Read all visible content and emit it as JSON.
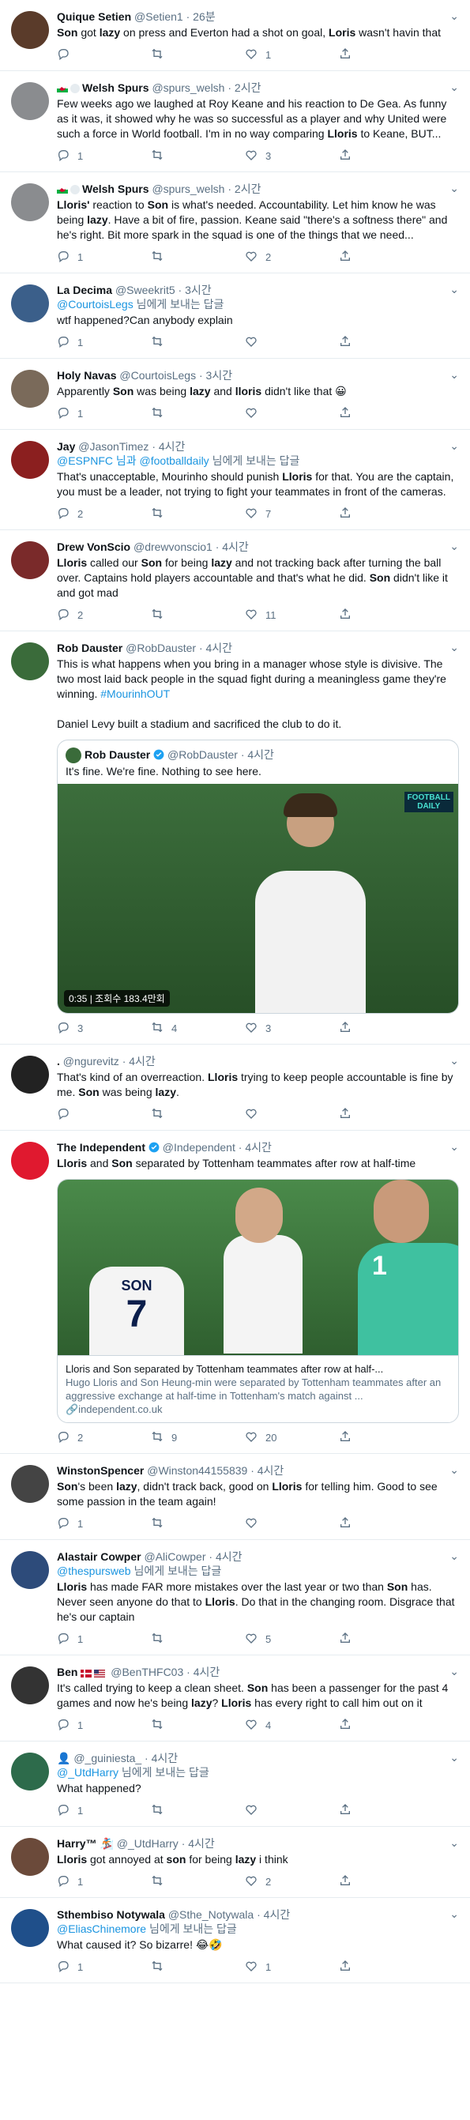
{
  "colors": {
    "accent": "#1da1f2",
    "muted": "#5b7083",
    "link": "#1b95e0",
    "border": "#e6ecf0"
  },
  "labels": {
    "reply_prefix": "@",
    "reply_to": "님에게 보내는 답글",
    "retweeted": ""
  },
  "tweets": [
    {
      "name": "Quique Setien",
      "handle": "@Setien1",
      "time": "26분",
      "avatar_color": "#5a3b2a",
      "body_html": "<b>Son</b> got <b>lazy</b> on press and Everton had a shot on goal, <b>Loris</b> wasn't havin that",
      "reply_count": "",
      "rt_count": "",
      "like_count": "1"
    },
    {
      "name": "Welsh Spurs",
      "handle": "@spurs_welsh",
      "time": "2시간",
      "flags": true,
      "avatar_color": "#8a8c8f",
      "body_html": "Few weeks ago we laughed at Roy Keane and his reaction to De Gea. As funny as it was, it showed why he was so successful as a player and why United were such a force in World football. I'm in no way comparing <b>Lloris</b> to Keane, BUT...",
      "reply_count": "1",
      "rt_count": "",
      "like_count": "3"
    },
    {
      "name": "Welsh Spurs",
      "handle": "@spurs_welsh",
      "time": "2시간",
      "flags": true,
      "avatar_color": "#8a8c8f",
      "body_html": "<b>Lloris'</b> reaction to <b>Son</b> is what's needed. Accountability. Let him know he was being <b>lazy</b>. Have a bit of fire, passion. Keane said \"there's a softness there\" and he's right. Bit more spark in the squad is one of the things that we need...",
      "reply_count": "1",
      "rt_count": "",
      "like_count": "2"
    },
    {
      "name": "La Decima",
      "handle": "@Sweekrit5",
      "time": "3시간",
      "avatar_color": "#3b5f8a",
      "reply_to": "@CourtoisLegs",
      "body_html": "wtf happened?Can anybody explain",
      "reply_count": "1",
      "rt_count": "",
      "like_count": ""
    },
    {
      "name": "Holy Navas",
      "handle": "@CourtoisLegs",
      "time": "3시간",
      "avatar_color": "#7a6a5a",
      "body_html": "Apparently <b>Son</b> was being <b>lazy</b> and <b>lloris</b> didn't like that 😀",
      "reply_count": "1",
      "rt_count": "",
      "like_count": ""
    },
    {
      "name": "Jay",
      "handle": "@JasonTimez",
      "time": "4시간",
      "avatar_color": "#8b1f1f",
      "reply_to": "@ESPNFC 님과 @footballdaily",
      "body_html": "That's unacceptable, Mourinho should punish <b>Lloris</b> for that. You are the captain, you must be a leader, not trying to fight your teammates in front of the cameras.",
      "reply_count": "2",
      "rt_count": "",
      "like_count": "7"
    },
    {
      "name": "Drew VonScio",
      "handle": "@drewvonscio1",
      "time": "4시간",
      "avatar_color": "#7a2a2a",
      "body_html": "<b>Lloris</b> called our <b>Son</b> for being <b>lazy</b> and not tracking back after turning the ball over. Captains hold players accountable and that's what he did. <b>Son</b> didn't like it and got mad",
      "reply_count": "2",
      "rt_count": "",
      "like_count": "11"
    },
    {
      "name": "Rob Dauster",
      "handle": "@RobDauster",
      "time": "4시간",
      "avatar_color": "#3a6b3a",
      "body_html": "This is what happens when you bring in a manager whose style is divisive. The two most laid back people in the squad fight during a meaningless game they're winning. <span class=\"link\">#MourinhOUT</span><br><br>Daniel Levy built a stadium and sacrificed the club to do it.",
      "quote": {
        "name": "Rob Dauster",
        "handle": "@RobDauster",
        "time": "4시간",
        "body": "It's fine. We're fine. Nothing to see here.",
        "badge_line1": "FOOTBALL",
        "badge_line2": "DAILY",
        "duration": "0:35",
        "views": "조회수 183.4만회"
      },
      "reply_count": "3",
      "rt_count": "4",
      "like_count": "3"
    },
    {
      "name": ".",
      "handle": "@ngurevitz",
      "time": "4시간",
      "avatar_color": "#222222",
      "body_html": "That's kind of an overreaction. <b>Lloris</b> trying to keep people accountable is fine by me. <b>Son</b> was being <b>lazy</b>.",
      "reply_count": "",
      "rt_count": "",
      "like_count": ""
    },
    {
      "name": "The Independent",
      "handle": "@Independent",
      "time": "4시간",
      "verified": true,
      "avatar_color": "#e0192f",
      "body_html": "<b>Lloris</b> and <b>Son</b> separated by Tottenham teammates after row at half-time",
      "card": {
        "title": "Lloris and Son separated by Tottenham teammates after row at half-...",
        "desc": "Hugo Lloris and Son Heung-min were separated by Tottenham teammates after an aggressive exchange at half-time in Tottenham's match against ...",
        "domain": "independent.co.uk",
        "shirt_name": "SON",
        "shirt_number": "7",
        "gk_number": "1"
      },
      "reply_count": "2",
      "rt_count": "9",
      "like_count": "20"
    },
    {
      "name": "WinstonSpencer",
      "handle": "@Winston44155839",
      "time": "4시간",
      "avatar_color": "#444444",
      "body_html": "<b>Son</b>'s been <b>lazy</b>, didn't track back, good on <b>Lloris</b> for telling him. Good to see some passion in the team again!",
      "reply_count": "1",
      "rt_count": "",
      "like_count": ""
    },
    {
      "name": "Alastair Cowper",
      "handle": "@AliCowper",
      "time": "4시간",
      "avatar_color": "#2d4b7a",
      "reply_to": "@thespursweb",
      "body_html": "<b>Lloris</b> has made FAR more mistakes over the last year or two than <b>Son</b> has. Never seen anyone do that to <b>Lloris</b>. Do that in the changing room. Disgrace that he's our captain",
      "reply_count": "1",
      "rt_count": "",
      "like_count": "5"
    },
    {
      "name": "Ben",
      "handle": "@BenTHFC03",
      "time": "4시간",
      "flags2": true,
      "avatar_color": "#333333",
      "body_html": "It's called trying to keep a clean sheet. <b>Son</b> has been a passenger for the past 4 games and now he's being <b>lazy</b>? <b>Lloris</b> has every right to call him out on it",
      "reply_count": "1",
      "rt_count": "",
      "like_count": "4"
    },
    {
      "name": "👤",
      "handle": "@_guiniesta_",
      "time": "4시간",
      "avatar_color": "#2d6b4b",
      "reply_to": "@_UtdHarry",
      "body_html": "What happened?",
      "reply_count": "1",
      "rt_count": "",
      "like_count": ""
    },
    {
      "name": "Harry™ 🏂",
      "handle": "@_UtdHarry",
      "time": "4시간",
      "avatar_color": "#6b4a3a",
      "body_html": "<b>Lloris</b> got annoyed at <b>son</b> for being <b>lazy</b> i think",
      "reply_count": "1",
      "rt_count": "",
      "like_count": "2"
    },
    {
      "name": "Sthembiso Notywala",
      "handle": "@Sthe_Notywala",
      "time": "4시간",
      "avatar_color": "#1f4f8a",
      "reply_to": "@EliasChinemore",
      "body_html": "What caused it? So bizarre! 😂🤣",
      "reply_count": "1",
      "rt_count": "",
      "like_count": "1"
    }
  ]
}
